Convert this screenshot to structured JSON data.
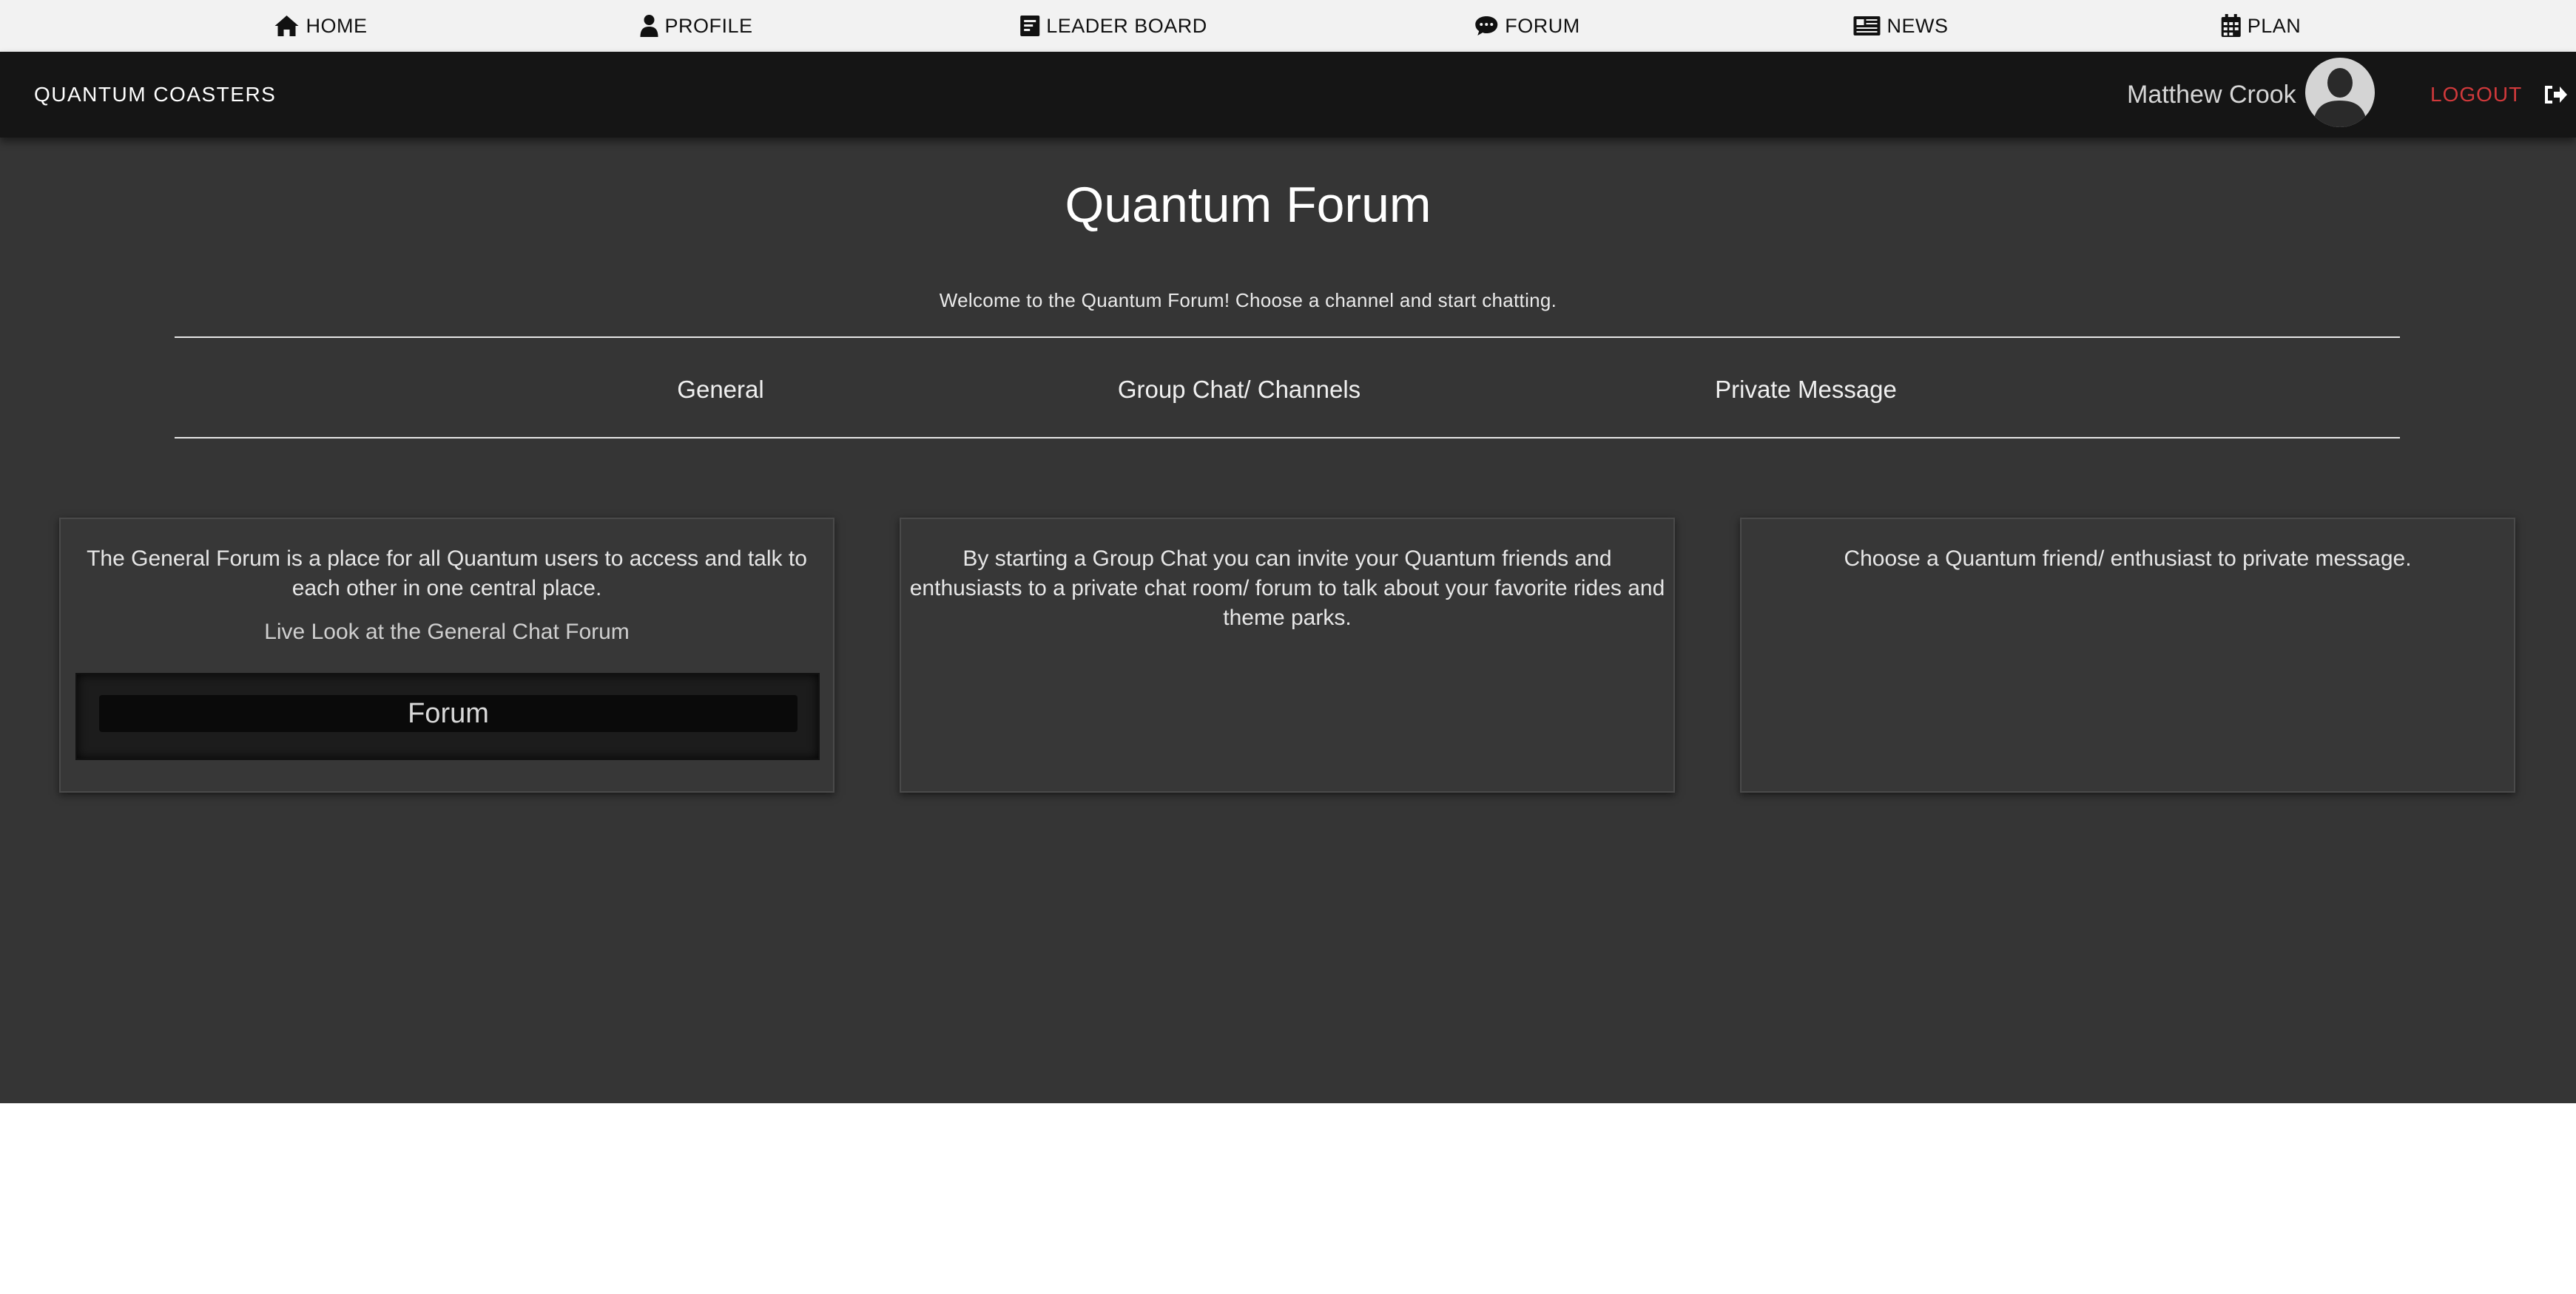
{
  "top_nav": {
    "items": [
      {
        "label": "HOME",
        "icon": "home-icon"
      },
      {
        "label": "PROFILE",
        "icon": "user-icon"
      },
      {
        "label": "LEADER BOARD",
        "icon": "leaderboard-icon"
      },
      {
        "label": "FORUM",
        "icon": "chat-icon"
      },
      {
        "label": "NEWS",
        "icon": "newspaper-icon"
      },
      {
        "label": "PLAN",
        "icon": "calendar-icon"
      }
    ]
  },
  "header": {
    "brand": "QUANTUM COASTERS",
    "user_name": "Matthew Crook",
    "avatar_icon": "avatar-silhouette-icon",
    "logout_label": "LOGOUT",
    "logout_icon": "sign-out-icon",
    "logout_color": "#d0393b"
  },
  "main": {
    "title": "Quantum Forum",
    "welcome": "Welcome to the Quantum Forum! Choose a channel and start chatting.",
    "tabs": [
      {
        "label": "General"
      },
      {
        "label": "Group Chat/ Channels"
      },
      {
        "label": "Private Message"
      }
    ],
    "cards": [
      {
        "description": "The General Forum is a place for all Quantum users to access and talk to each other in one central place.",
        "live_label": "Live Look at the General Chat Forum",
        "forum_label": "Forum"
      },
      {
        "description": "By starting a Group Chat you can invite your Quantum friends and enthusiasts to a private chat room/ forum to talk about your favorite rides and theme parks."
      },
      {
        "description": "Choose a Quantum friend/ enthusiast to private message."
      }
    ]
  },
  "colors": {
    "top_nav_bg": "#f2f2f2",
    "header_bg": "#151515",
    "main_bg": "#353535"
  }
}
